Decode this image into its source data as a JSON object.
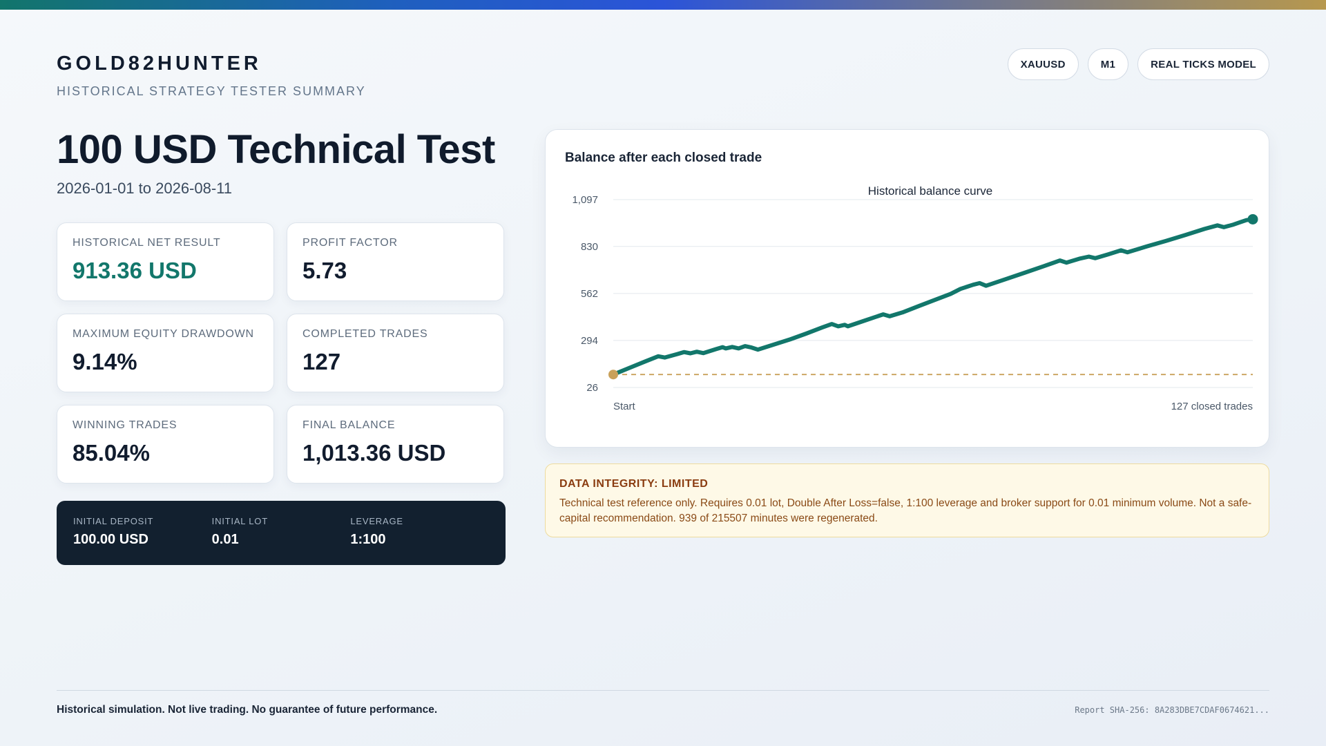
{
  "brand": "GOLD82HUNTER",
  "subtitle": "HISTORICAL STRATEGY TESTER SUMMARY",
  "pills": [
    "XAUUSD",
    "M1",
    "REAL TICKS MODEL"
  ],
  "report": {
    "title": "100 USD Technical Test",
    "date_range": "2026-01-01 to 2026-08-11"
  },
  "metrics": [
    {
      "label": "HISTORICAL NET RESULT",
      "value": "913.36 USD"
    },
    {
      "label": "PROFIT FACTOR",
      "value": "5.73"
    },
    {
      "label": "MAXIMUM EQUITY DRAWDOWN",
      "value": "9.14%"
    },
    {
      "label": "COMPLETED TRADES",
      "value": "127"
    },
    {
      "label": "WINNING TRADES",
      "value": "85.04%"
    },
    {
      "label": "FINAL BALANCE",
      "value": "1,013.36 USD"
    }
  ],
  "params": [
    {
      "label": "INITIAL DEPOSIT",
      "value": "100.00 USD"
    },
    {
      "label": "INITIAL LOT",
      "value": "0.01"
    },
    {
      "label": "LEVERAGE",
      "value": "1:100"
    }
  ],
  "chart_heading": "Balance after each closed trade",
  "chart_data": {
    "type": "line",
    "title": "Historical balance curve",
    "xlabel": "",
    "ylabel": "",
    "x_tick_labels": [
      "Start",
      "127 closed trades"
    ],
    "y_ticks": [
      "26",
      "294",
      "562",
      "830",
      "1,097"
    ],
    "y_tick_values": [
      26,
      294,
      562,
      830,
      1097
    ],
    "ylim": [
      26,
      1097
    ],
    "xlim": [
      0,
      127
    ],
    "grid": true,
    "reference_line": {
      "value": 100,
      "color": "#c9a15a"
    },
    "series": [
      {
        "color": "#12776b",
        "points": [
          [
            0,
            100
          ],
          [
            5,
            138
          ],
          [
            10,
            175
          ],
          [
            14,
            204
          ],
          [
            16,
            197
          ],
          [
            20,
            217
          ],
          [
            22,
            228
          ],
          [
            24,
            221
          ],
          [
            26,
            230
          ],
          [
            28,
            222
          ],
          [
            32,
            245
          ],
          [
            34,
            256
          ],
          [
            35,
            249
          ],
          [
            37,
            257
          ],
          [
            39,
            249
          ],
          [
            41,
            262
          ],
          [
            43,
            254
          ],
          [
            45,
            242
          ],
          [
            50,
            271
          ],
          [
            55,
            300
          ],
          [
            60,
            333
          ],
          [
            65,
            368
          ],
          [
            68,
            388
          ],
          [
            70,
            375
          ],
          [
            72,
            383
          ],
          [
            73,
            375
          ],
          [
            78,
            406
          ],
          [
            84,
            443
          ],
          [
            86,
            432
          ],
          [
            90,
            454
          ],
          [
            95,
            490
          ],
          [
            100,
            525
          ],
          [
            105,
            560
          ],
          [
            108,
            588
          ],
          [
            112,
            612
          ],
          [
            114,
            621
          ],
          [
            116,
            606
          ],
          [
            122,
            643
          ],
          [
            128,
            680
          ],
          [
            134,
            718
          ],
          [
            139,
            750
          ],
          [
            141,
            738
          ],
          [
            145,
            760
          ],
          [
            148,
            772
          ],
          [
            150,
            763
          ],
          [
            154,
            785
          ],
          [
            158,
            808
          ],
          [
            160,
            797
          ],
          [
            166,
            830
          ],
          [
            172,
            862
          ],
          [
            178,
            895
          ],
          [
            184,
            930
          ],
          [
            188,
            950
          ],
          [
            190,
            940
          ],
          [
            193,
            955
          ],
          [
            195,
            968
          ],
          [
            197,
            980
          ],
          [
            199,
            985
          ]
        ],
        "final_value": 1013.36
      }
    ]
  },
  "warning": {
    "title": "DATA INTEGRITY: LIMITED",
    "text": "Technical test reference only. Requires 0.01 lot, Double After Loss=false, 1:100 leverage and broker support for 0.01 minimum volume. Not a safe-capital recommendation. 939 of 215507 minutes were regenerated."
  },
  "footer": {
    "disclaimer": "Historical simulation. Not live trading. No guarantee of future performance.",
    "hash": "Report SHA-256: 8A283DBE7CDAF0674621..."
  },
  "colors": {
    "accent_green": "#12776b",
    "gold": "#c9a15a",
    "dark_panel": "#12202f",
    "warning_bg": "#fef9e7",
    "warning_text": "#8a3c10"
  }
}
